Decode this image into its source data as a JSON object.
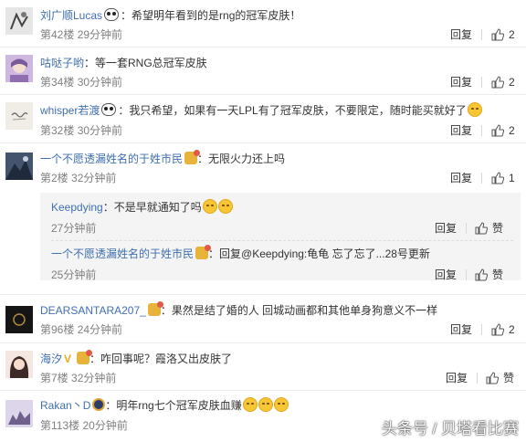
{
  "ui": {
    "reply_label": "回复",
    "like_label": "赞"
  },
  "comments": [
    {
      "user": "刘广顺Lucas",
      "text": "：希望明年看到的是rng的冠军皮肤！",
      "floor": "第42楼",
      "time": "29分钟前",
      "likes": "2"
    },
    {
      "user": "咕哒子哟",
      "text": "：等一套RNG总冠军皮肤",
      "floor": "第34楼",
      "time": "30分钟前",
      "likes": "2"
    },
    {
      "user": "whisper若渡",
      "text": "：我只希望，如果有一天LPL有了冠军皮肤，不要限定，随时能买就好了",
      "floor": "第32楼",
      "time": "30分钟前",
      "likes": "2"
    },
    {
      "user": "一个不愿透漏姓名的于姓市民",
      "text": "：无限火力还上吗",
      "floor": "第2楼",
      "time": "32分钟前",
      "likes": "1",
      "replies": [
        {
          "user": "Keepdying",
          "text": "：不是早就通知了吗",
          "time": "27分钟前"
        },
        {
          "user": "一个不愿透漏姓名的于姓市民",
          "text": "：回复@Keepdying:龟龟 忘了忘了...28号更新",
          "time": "25分钟前"
        }
      ]
    },
    {
      "user": "DEARSANTARA207_",
      "text": "：果然是结了婚的人 回城动画都和其他单身狗意义不一样",
      "floor": "第96楼",
      "time": "24分钟前",
      "likes": "2"
    },
    {
      "user": "海汐",
      "text": "：咋回事呢？霞洛又出皮肤了",
      "floor": "第7楼",
      "time": "32分钟前",
      "likes": ""
    },
    {
      "user": "Rakan丶D",
      "text": "：明年rng七个冠军皮肤血赚",
      "floor": "第113楼",
      "time": "20分钟前",
      "likes": ""
    }
  ],
  "watermark": "头条号 / 贝塔看比赛",
  "colors": {
    "username": "#3f6fb0",
    "meta": "#808080",
    "subbox": "#f4f4f4"
  }
}
